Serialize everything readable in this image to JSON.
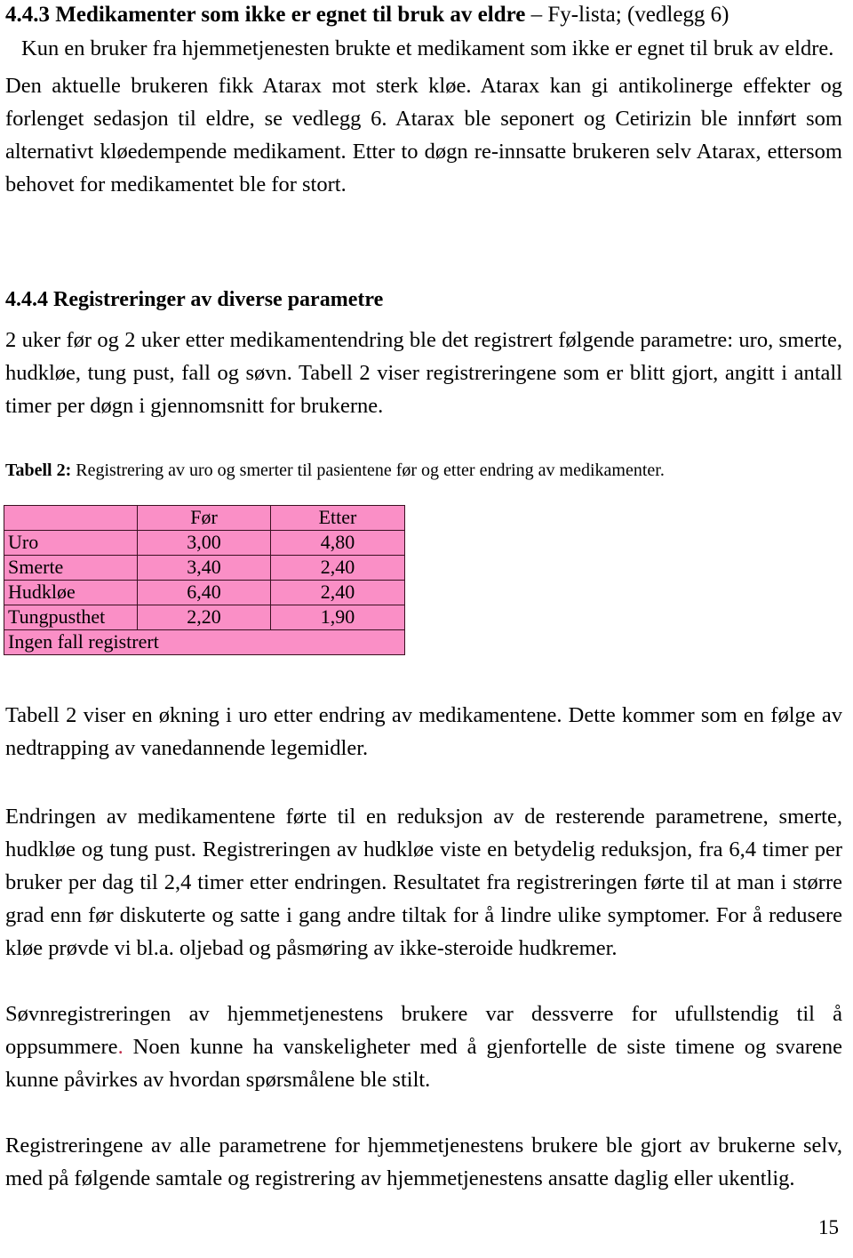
{
  "document": {
    "page_number": "15"
  },
  "headings": {
    "h3_bold": "4.4.3 Medikamenter som ikke er egnet til bruk av eldre",
    "h3_rest": " – Fy-lista; (vedlegg 6)",
    "h4": "4.4.4 Registreringer av diverse parametre"
  },
  "paragraphs": {
    "p1": "Kun en bruker fra hjemmetjenesten brukte et medikament som ikke er egnet til bruk av eldre.",
    "p2": "Den aktuelle brukeren fikk Atarax mot sterk kløe. Atarax kan gi antikolinerge effekter og forlenget sedasjon til eldre, se vedlegg 6. Atarax ble seponert og Cetirizin ble innført som alternativt kløedempende medikament. Etter to døgn re-innsatte brukeren selv Atarax, ettersom behovet for medikamentet ble for stort.",
    "p3": "2 uker før og 2 uker etter medikamentendring ble det registrert følgende parametre: uro, smerte, hudkløe, tung pust, fall og søvn. Tabell 2 viser registreringene som er blitt gjort, angitt i antall timer per døgn i gjennomsnitt for brukerne.",
    "p4": "Tabell 2 viser en økning i uro etter endring av medikamentene. Dette kommer som en følge av nedtrapping av vanedannende legemidler.",
    "p5": "Endringen av medikamentene førte til en reduksjon av de resterende parametrene, smerte, hudkløe og tung pust. Registreringen av hudkløe viste en betydelig reduksjon, fra 6,4 timer per bruker per dag til 2,4 timer etter endringen. Resultatet fra registreringen førte til at man i større grad enn før diskuterte og satte i gang andre tiltak for å lindre ulike symptomer. For å redusere kløe prøvde vi bl.a. oljebad og påsmøring av ikke-steroide hudkremer.",
    "p6_a": "Søvnregistreringen av hjemmetjenestens brukere var dessverre for ufullstendig til å oppsummere",
    "p6_punct": ".",
    "p6_b": " Noen kunne ha vanskeligheter med å gjenfortelle de siste timene og svarene kunne påvirkes av hvordan spørsmålene ble stilt.",
    "p7": "Registreringene av alle parametrene for hjemmetjenestens brukere ble gjort av brukerne selv, med på følgende samtale og registrering av hjemmetjenestens ansatte daglig eller ukentlig."
  },
  "table_caption": {
    "bold": "Tabell 2:",
    "rest": " Registrering av uro og smerter til pasientene før og etter endring av medikamenter."
  },
  "table": {
    "background_color": "#FA8FC6",
    "border_color": "#3A1020",
    "header": [
      "",
      "Før",
      "Etter"
    ],
    "rows": [
      {
        "label": "Uro",
        "for": "3,00",
        "etter": "4,80"
      },
      {
        "label": "Smerte",
        "for": "3,40",
        "etter": "2,40"
      },
      {
        "label": "Hudkløe",
        "for": "6,40",
        "etter": "2,40"
      },
      {
        "label": "Tungpusthet",
        "for": "2,20",
        "etter": "1,90"
      }
    ],
    "footer_note": "Ingen fall registrert"
  },
  "chart_data": {
    "type": "table",
    "title": "Tabell 2: Registrering av uro og smerter til pasientene før og etter endring av medikamenter.",
    "categories": [
      "Uro",
      "Smerte",
      "Hudkløe",
      "Tungpusthet"
    ],
    "series": [
      {
        "name": "Før",
        "values": [
          3.0,
          3.4,
          6.4,
          2.2
        ]
      },
      {
        "name": "Etter",
        "values": [
          4.8,
          2.4,
          2.4,
          1.9
        ]
      }
    ],
    "ylabel": "Antall timer per døgn i gjennomsnitt",
    "note": "Ingen fall registrert"
  }
}
